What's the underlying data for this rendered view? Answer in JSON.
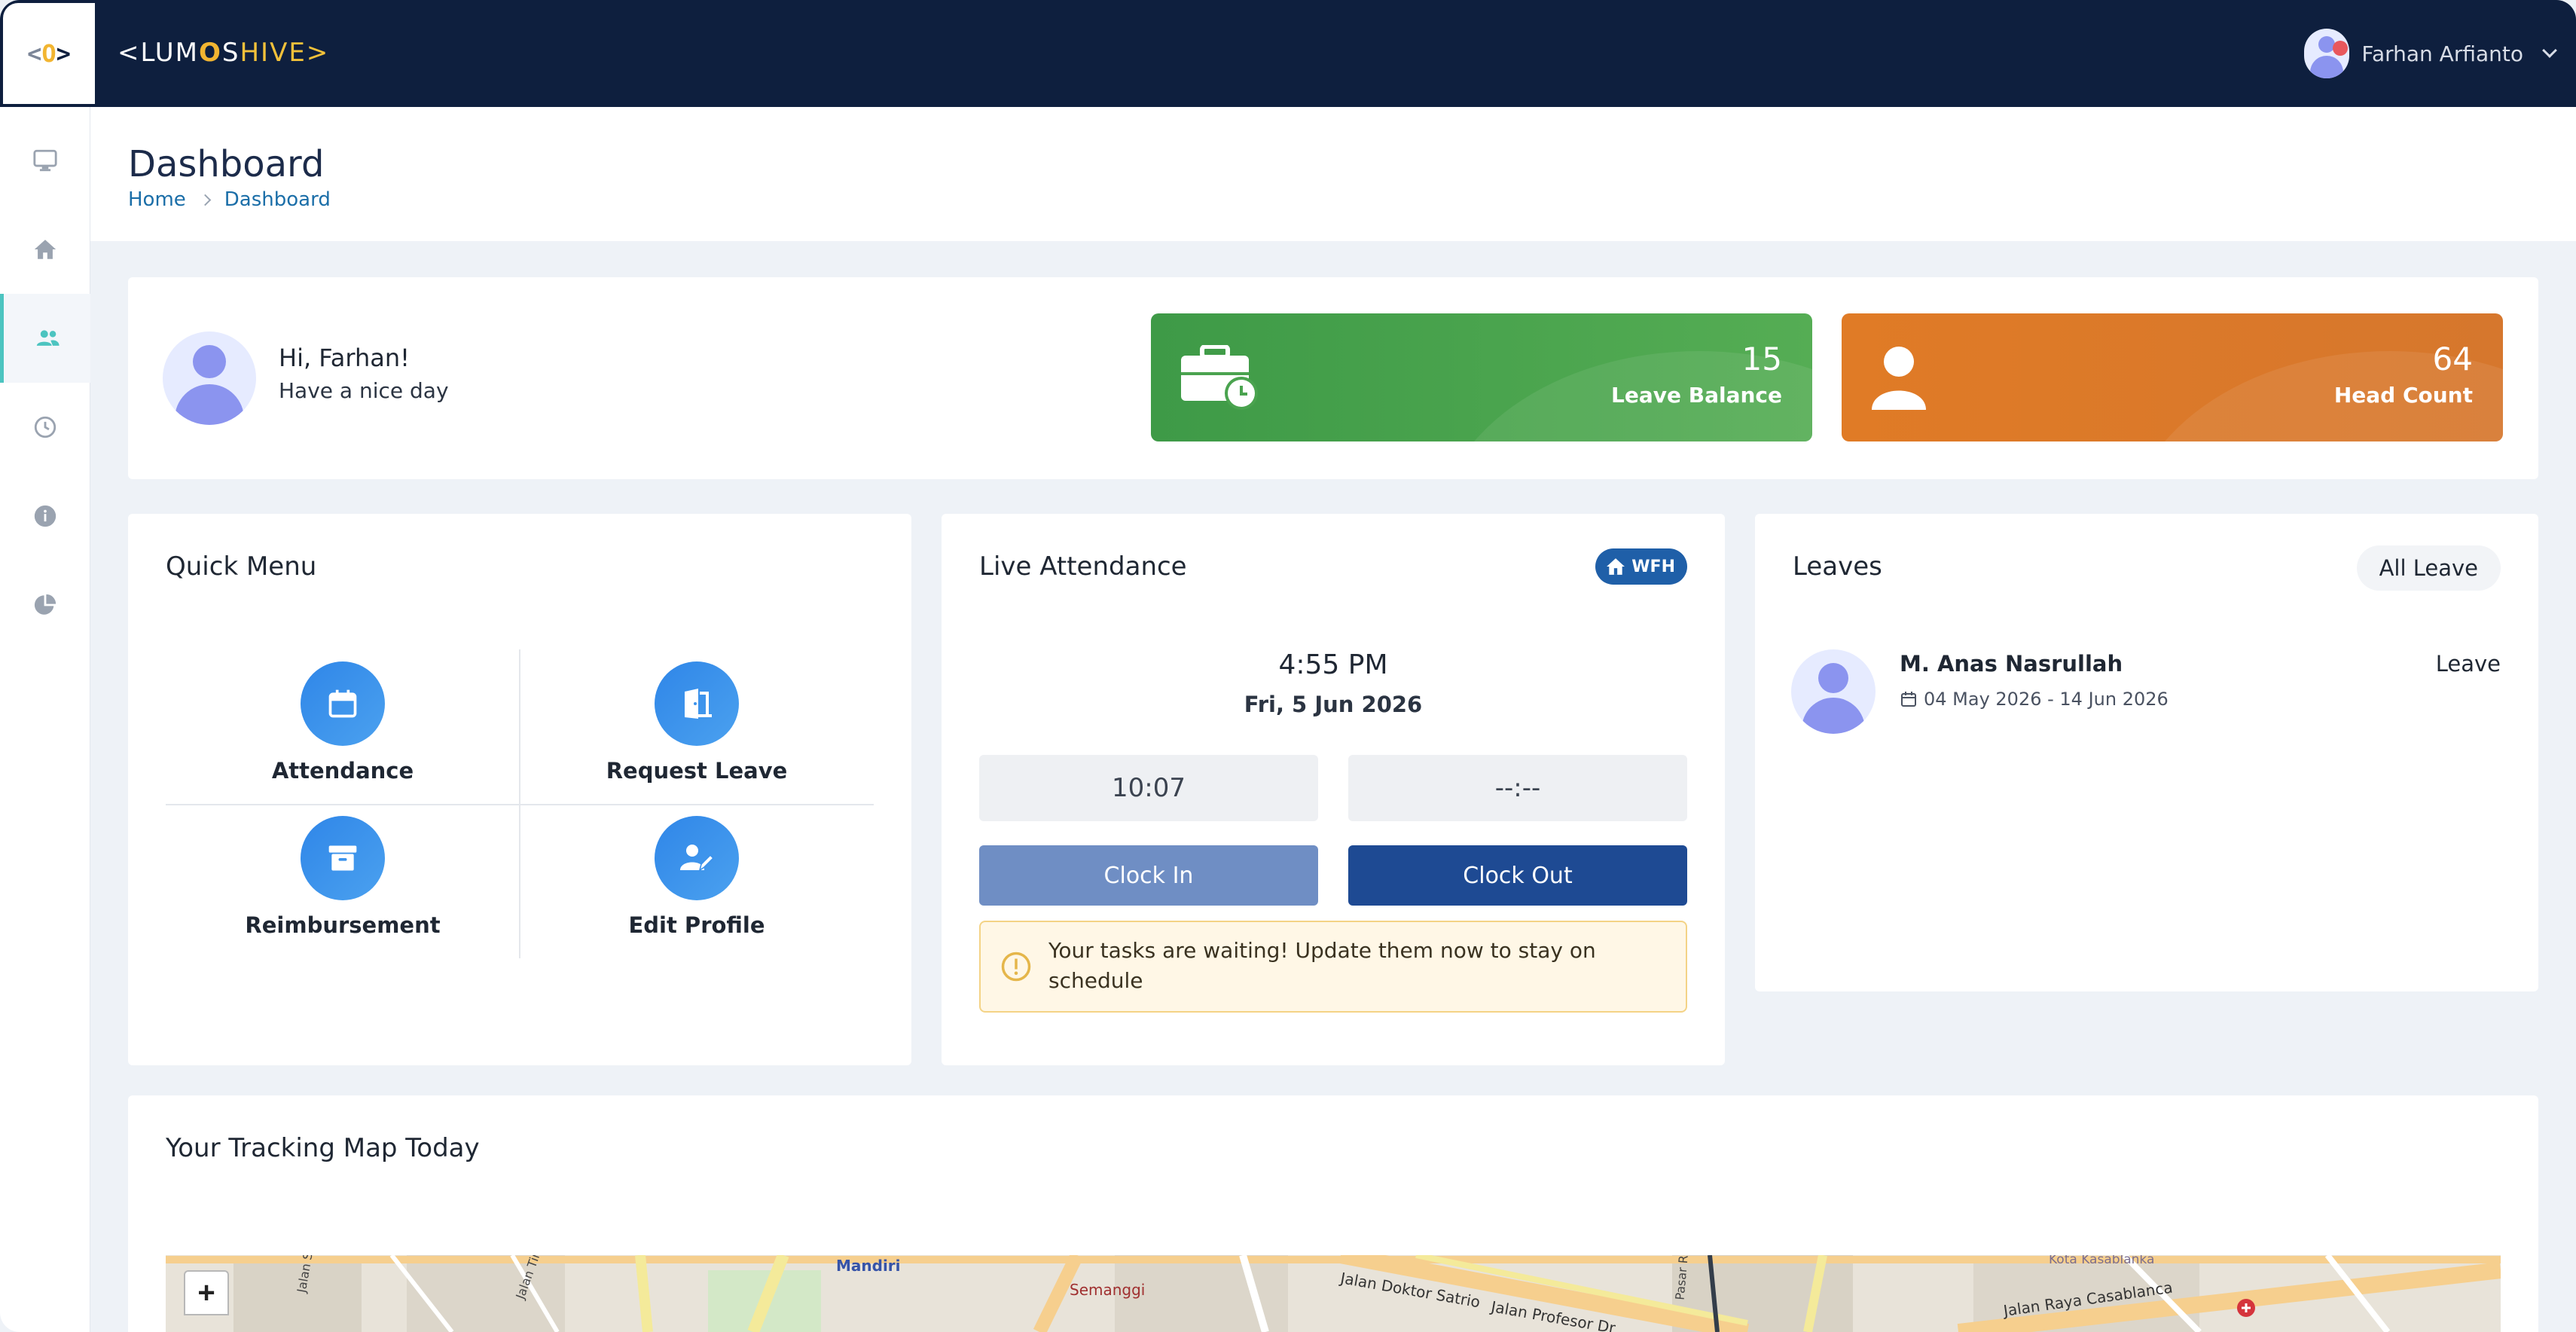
{
  "brand": {
    "name_left": "<LUM",
    "name_o": "O",
    "name_s": "S",
    "name_right": "HIVE>",
    "logo_left": "<",
    "logo_bulb": "O",
    "logo_right": ">"
  },
  "user": {
    "name": "Farhan Arfianto"
  },
  "header": {
    "title": "Dashboard",
    "breadcrumb": [
      "Home",
      "Dashboard"
    ]
  },
  "welcome": {
    "greeting": "Hi, Farhan!",
    "subtitle": "Have a nice day"
  },
  "stats": [
    {
      "value": "15",
      "label": "Leave Balance",
      "color": "#4aa34f"
    },
    {
      "value": "64",
      "label": "Head Count",
      "color": "#db7a2a"
    }
  ],
  "quick_menu": {
    "title": "Quick Menu",
    "items": [
      {
        "label": "Attendance",
        "icon": "calendar-icon"
      },
      {
        "label": "Request Leave",
        "icon": "door-exit-icon"
      },
      {
        "label": "Reimbursement",
        "icon": "archive-box-icon"
      },
      {
        "label": "Edit Profile",
        "icon": "user-edit-icon"
      }
    ]
  },
  "live_attendance": {
    "title": "Live Attendance",
    "mode_badge": "WFH",
    "time": "4:55 PM",
    "date": "Fri, 5 Jun 2026",
    "clock_in_time": "10:07",
    "clock_out_time": "--:--",
    "clock_in_label": "Clock In",
    "clock_out_label": "Clock Out",
    "alert": "Your tasks are waiting! Update them now to stay on schedule"
  },
  "leaves": {
    "title": "Leaves",
    "all_label": "All Leave",
    "items": [
      {
        "name": "M. Anas Nasrullah",
        "type": "Leave",
        "dates": "04 May 2026 - 14 Jun 2026"
      }
    ]
  },
  "map": {
    "title": "Your Tracking Map Today",
    "zoom_in": "+",
    "labels": [
      "Mandiri",
      "Semanggi",
      "Jalan Doktor Satrio",
      "Jalan Profesor Dr",
      "Jalan Raya Casablanca",
      "Kota Kasablanka",
      "Jalan Sin",
      "Jalan Tirai",
      "Pasar Raya"
    ]
  },
  "colors": {
    "topbar": "#0e1f3e",
    "accent": "#4cc4c0",
    "primary": "#1e4a93",
    "icon_blue": "#3b92ec"
  }
}
